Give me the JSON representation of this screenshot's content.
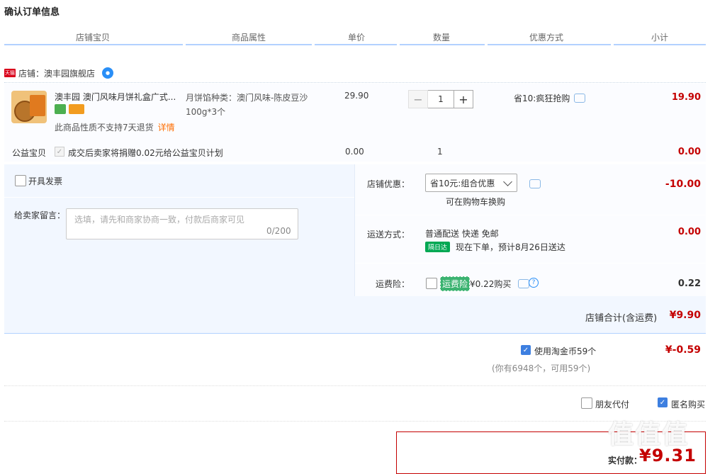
{
  "page_title": "确认订单信息",
  "columns": [
    "店铺宝贝",
    "商品属性",
    "单价",
    "数量",
    "优惠方式",
    "小计"
  ],
  "shop": {
    "badge": "天猫",
    "label": "店铺：澳丰园旗舰店"
  },
  "item": {
    "name": "澳丰园 澳门风味月饼礼盒广式...",
    "attr_line1": "月饼馅种类：澳门风味-陈皮豆沙",
    "attr_line2": "100g*3个",
    "no_refund": "此商品性质不支持7天退货",
    "detail_link": "详情",
    "price": "29.90",
    "qty_minus": "−",
    "qty_value": "1",
    "qty_plus": "+",
    "promo": "省10:疯狂抢购",
    "subtotal": "19.90"
  },
  "charity": {
    "label": "公益宝贝",
    "check": "✓",
    "text": "成交后卖家将捐赠0.02元给公益宝贝计划",
    "price": "0.00",
    "qty": "1",
    "subtotal": "0.00"
  },
  "invoice_label": "开具发票",
  "message": {
    "label": "给卖家留言：",
    "placeholder": "选填，请先和商家协商一致，付款后商家可见",
    "count": "0/200"
  },
  "shop_discount": {
    "label": "店铺优惠：",
    "selected": "省10元:组合优惠",
    "redeem": "可在购物车换购",
    "value": "-10.00"
  },
  "shipping": {
    "label": "运送方式：",
    "method": "普通配送 快递 免邮",
    "tag": "隔日达",
    "eta": "现在下单，预计8月26日送达",
    "value": "0.00"
  },
  "insurance": {
    "label": "运费险：",
    "tag": "运费险",
    "price": "¥0.22购买",
    "help": "?",
    "value": "0.22"
  },
  "shop_total": {
    "label": "店铺合计(含运费)",
    "value": "¥9.90"
  },
  "coins": {
    "check": "✓",
    "label": "使用淘金币59个",
    "note": "(你有6948个，可用59个)",
    "value": "¥-0.59"
  },
  "friend_pay_label": "朋友代付",
  "anonymous": {
    "check": "✓",
    "label": "匿名购买"
  },
  "payment": {
    "label": "实付款：",
    "amount": "¥9.31"
  },
  "watermark": "值值值",
  "colors": {
    "price_red": "#c40000",
    "accent_blue": "#3d7fe0",
    "panel_bg": "#f2f7ff",
    "header_line": "#b2d1ff"
  }
}
